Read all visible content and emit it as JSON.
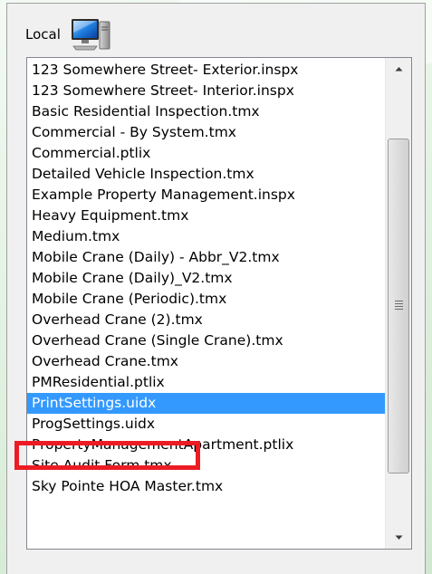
{
  "header": {
    "label": "Local",
    "icon": "computer-icon"
  },
  "list": {
    "selected_index": 16,
    "items": [
      "123 Somewhere Street- Exterior.inspx",
      "123 Somewhere Street- Interior.inspx",
      "Basic Residential Inspection.tmx",
      "Commercial - By System.tmx",
      "Commercial.ptlix",
      "Detailed Vehicle Inspection.tmx",
      "Example Property Management.inspx",
      "Heavy Equipment.tmx",
      "Medium.tmx",
      "Mobile Crane (Daily) - Abbr_V2.tmx",
      "Mobile Crane (Daily)_V2.tmx",
      "Mobile Crane (Periodic).tmx",
      "Overhead Crane (2).tmx",
      "Overhead Crane (Single Crane).tmx",
      "Overhead Crane.tmx",
      "PMResidential.ptlix",
      "PrintSettings.uidx",
      "ProgSettings.uidx",
      "PropertyManagementApartment.ptlix",
      "Site Audit Form.tmx",
      "Sky Pointe HOA Master.tmx"
    ]
  },
  "colors": {
    "selection": "#3399ff",
    "annotation": "#ec1c24"
  }
}
